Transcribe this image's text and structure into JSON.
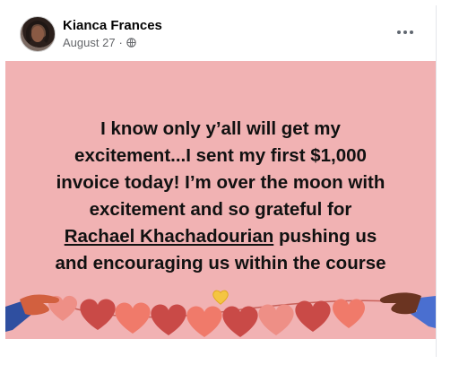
{
  "post": {
    "author": "Kianca Frances",
    "date": "August 27",
    "separator": "·",
    "privacy_icon": "globe-icon",
    "more_icon": "more-options-icon"
  },
  "image": {
    "background_color": "#f1b2b3",
    "text_line_1": "I know only y’all will get my",
    "text_line_2": "excitement...I sent my first $1,000",
    "text_line_3": "invoice today! I’m over the moon with",
    "text_line_4": "excitement and so grateful for",
    "tagged_name": "Rachael Khachadourian",
    "text_line_5_rest": " pushing us",
    "text_line_6": "and encouraging us within the course",
    "emoji": "yellow-heart-icon"
  },
  "colors": {
    "heart_light": "#f07a6a",
    "heart_dark": "#c94a47",
    "heart_pink": "#ee8f86",
    "hand_left": "#d2603f",
    "hand_right": "#6b3421",
    "sleeve_left": "#2f4fa0",
    "sleeve_right": "#4a6fd0"
  }
}
